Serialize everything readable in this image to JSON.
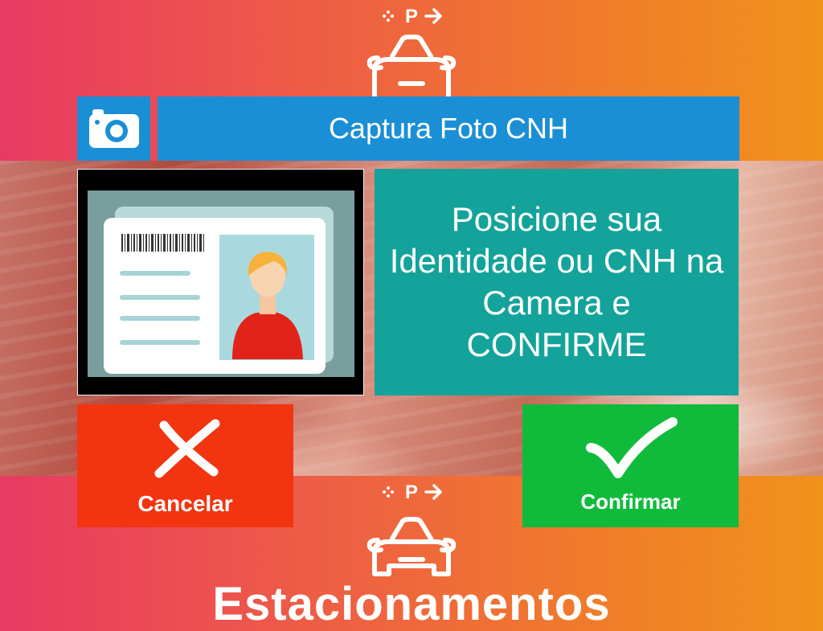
{
  "header": {
    "title": "Captura Foto CNH",
    "camera_icon": "camera-icon"
  },
  "instruction": {
    "text": "Posicione sua Identidade ou CNH na Camera e CONFIRME"
  },
  "preview": {
    "icon": "id-card-illustration"
  },
  "actions": {
    "cancel_label": "Cancelar",
    "confirm_label": "Confirmar",
    "cancel_icon": "x-icon",
    "confirm_icon": "checkmark-icon"
  },
  "branding": {
    "name": "Estacionamentos",
    "logo_letter": "P"
  },
  "colors": {
    "title_bar": "#1b8fd6",
    "instruction_bg": "#14a39a",
    "cancel_bg": "#f23411",
    "confirm_bg": "#10bb3c"
  }
}
